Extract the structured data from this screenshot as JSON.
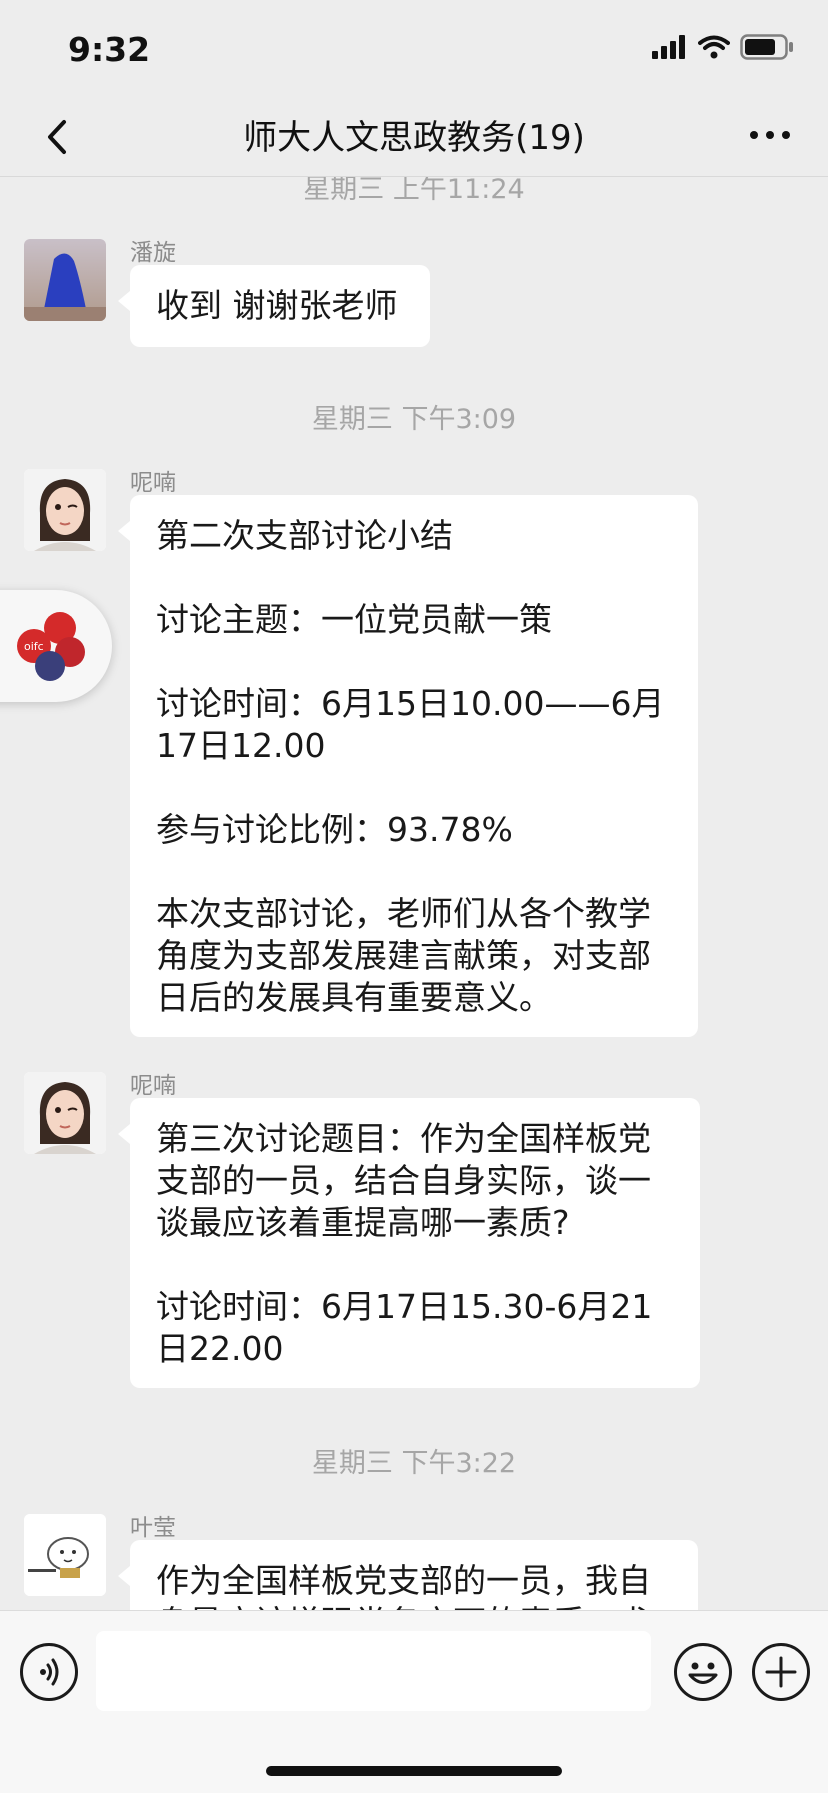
{
  "status_bar": {
    "time": "9:32"
  },
  "nav": {
    "title": "师大人文思政教务(19)"
  },
  "messages": [
    {
      "type": "timestamp",
      "text": "星期三 上午11:24"
    },
    {
      "type": "msg",
      "sender": "潘旋",
      "text": "收到 谢谢张老师"
    },
    {
      "type": "timestamp",
      "text": "星期三 下午3:09"
    },
    {
      "type": "msg",
      "sender": "呢喃",
      "text": "第二次支部讨论小结\n\n讨论主题：一位党员献一策\n\n讨论时间：6月15日10.00——6月17日12.00\n\n参与讨论比例：93.78%\n\n本次支部讨论，老师们从各个教学角度为支部发展建言献策，对支部日后的发展具有重要意义。"
    },
    {
      "type": "msg",
      "sender": "呢喃",
      "text": "第三次讨论题目：作为全国样板党支部的一员，结合自身实际，谈一谈最应该着重提高哪一素质?\n\n讨论时间：6月17日15.30-6月21日22.00"
    },
    {
      "type": "timestamp",
      "text": "星期三 下午3:22"
    },
    {
      "type": "msg",
      "sender": "叶莹",
      "text": "作为全国样板党支部的一员，我自身最应该增强党务方面的素质，尤"
    }
  ],
  "floating_logo_text": "oifc",
  "input": {
    "value": ""
  },
  "colors": {
    "background": "#ededed",
    "bubble": "#ffffff",
    "input_bar": "#f7f7f7"
  },
  "icons": [
    "back-icon",
    "more-icon",
    "voice-icon",
    "emoji-icon",
    "plus-icon",
    "signal-icon",
    "wifi-icon",
    "battery-icon"
  ]
}
